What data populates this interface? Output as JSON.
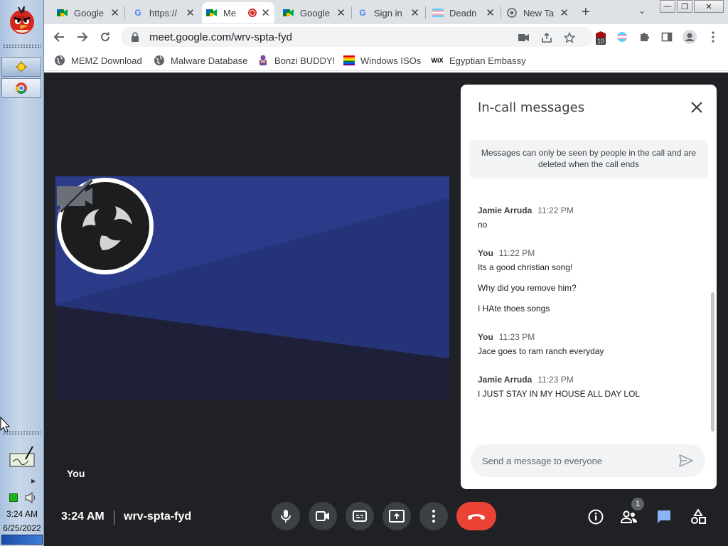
{
  "taskbar": {
    "clock_time": "3:24 AM",
    "clock_date": "6/25/2022"
  },
  "tabs": [
    {
      "title": "Google",
      "icon": "google-meet-icon"
    },
    {
      "title": "https://",
      "icon": "google-g-icon"
    },
    {
      "title": "Me",
      "icon": "google-meet-icon",
      "active": true,
      "recording": true
    },
    {
      "title": "Google",
      "icon": "google-meet-icon"
    },
    {
      "title": "Sign in",
      "icon": "google-g-icon"
    },
    {
      "title": "Deadn",
      "icon": "trans-flag-icon"
    },
    {
      "title": "New Ta",
      "icon": "chrome-icon"
    }
  ],
  "toolbar": {
    "url": "meet.google.com/wrv-spta-fyd",
    "extension_badge": "10"
  },
  "bookmarks": [
    {
      "label": "MEMZ Download",
      "icon": "globe-icon"
    },
    {
      "label": "Malware Database",
      "icon": "globe-icon"
    },
    {
      "label": "Bonzi BUDDY!",
      "icon": "bonzi-icon"
    },
    {
      "label": "Windows ISOs",
      "icon": "rainbow-icon"
    },
    {
      "label": "Egyptian Embassy",
      "icon": "wix-icon",
      "icon_text": "WiX"
    }
  ],
  "meet": {
    "self_label": "You",
    "time": "3:24 AM",
    "meeting_code": "wrv-spta-fyd",
    "people_count": "1"
  },
  "chat": {
    "title": "In-call messages",
    "notice": "Messages can only be seen by people in the call and are deleted when the call ends",
    "input_placeholder": "Send a message to everyone",
    "groups": [
      {
        "sender": "Jamie Arruda",
        "time": "11:22 PM",
        "messages": [
          "no"
        ]
      },
      {
        "sender": "You",
        "time": "11:22 PM",
        "messages": [
          "Its a good christian song!",
          "Why did you remove him?",
          "I HAte thoes songs"
        ]
      },
      {
        "sender": "You",
        "time": "11:23 PM",
        "messages": [
          "Jace goes to ram ranch everyday"
        ]
      },
      {
        "sender": "Jamie Arruda",
        "time": "11:23 PM",
        "messages": [
          "I JUST STAY IN MY HOUSE ALL DAY LOL"
        ]
      }
    ]
  },
  "colors": {
    "accent_blue": "#1a73e8",
    "end_call_red": "#ea4335",
    "tile_blue": "#2d3e8c"
  }
}
